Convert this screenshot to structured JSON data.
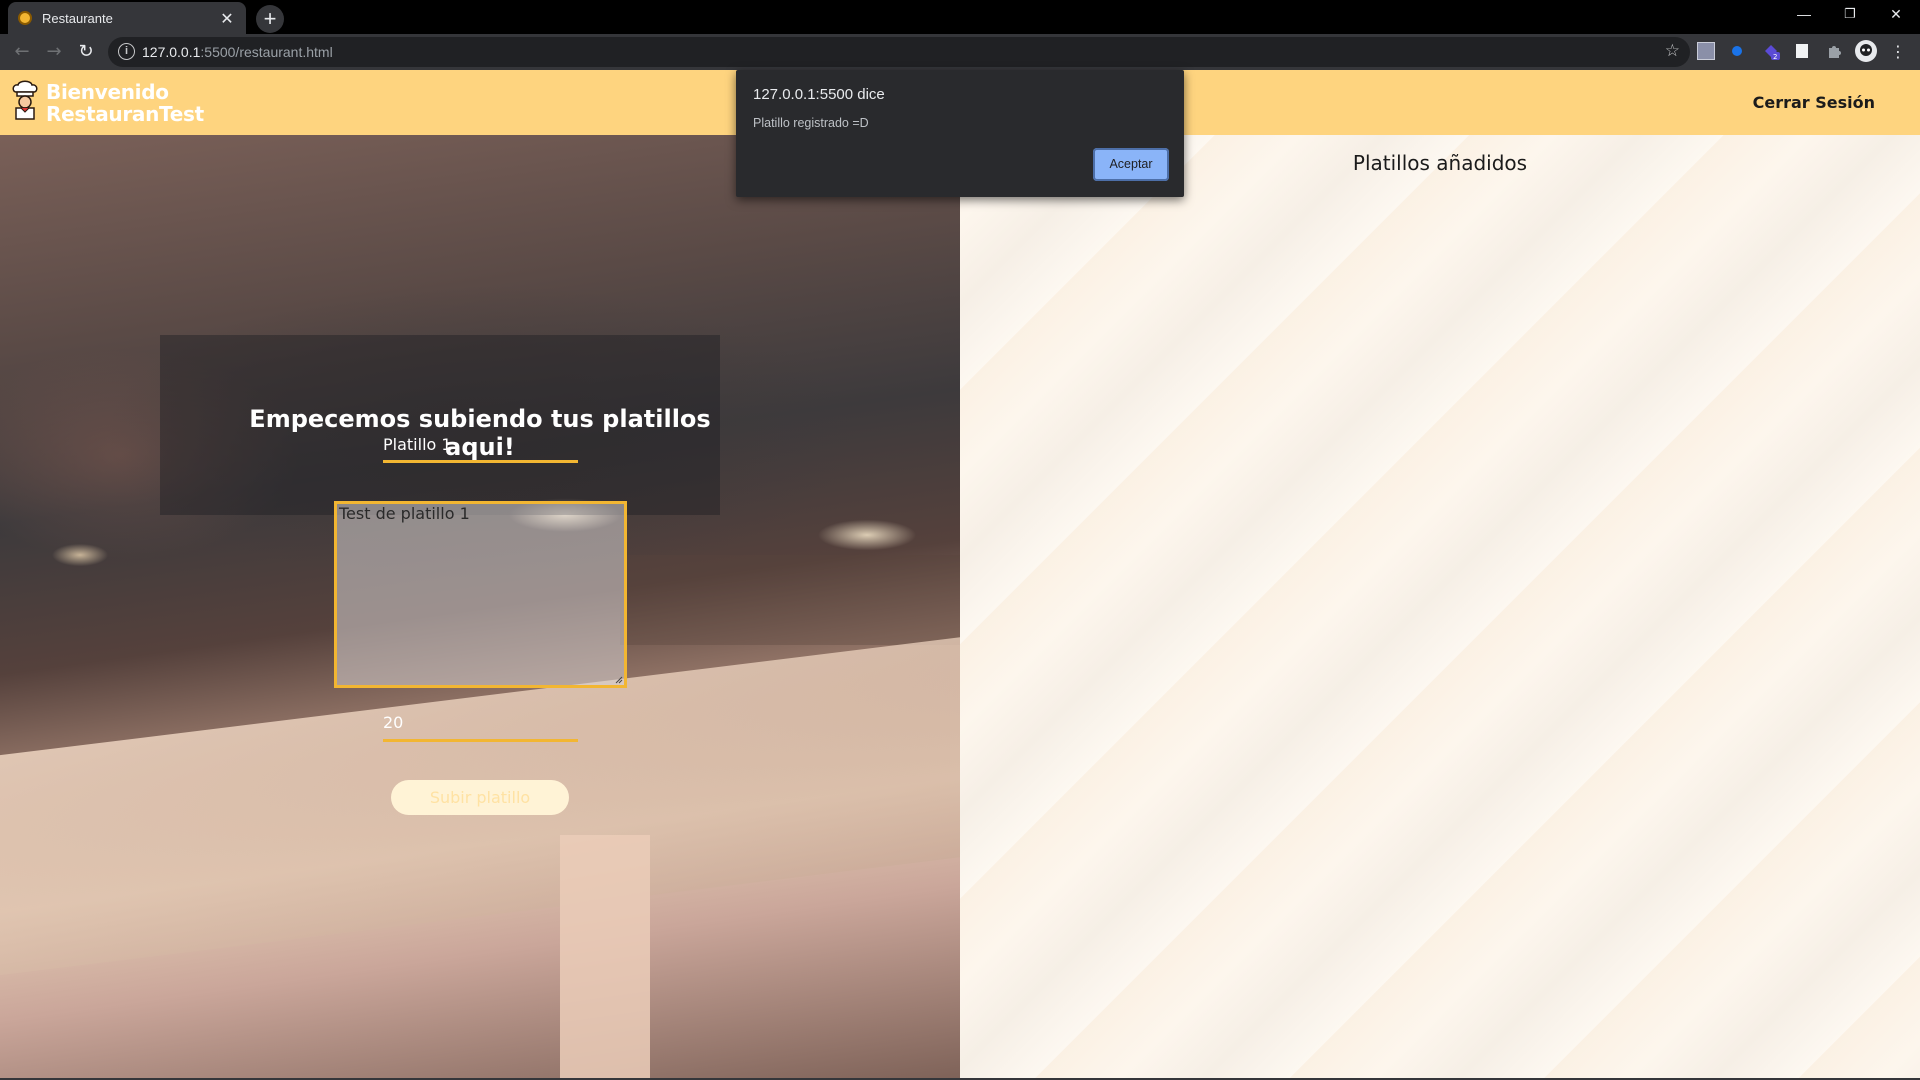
{
  "browser": {
    "tab_title": "Restaurante",
    "tab_close": "✕",
    "new_tab": "+",
    "url_host": "127.0.0.1",
    "url_rest": ":5500/restaurant.html",
    "window_controls": {
      "minimize": "—",
      "restore": "❐",
      "close": "✕"
    }
  },
  "header": {
    "brand_line1": "Bienvenido",
    "brand_line2": "RestauranTest",
    "logout_label": "Cerrar Sesión"
  },
  "form": {
    "title": "Empecemos subiendo tus platillos aqui!",
    "dish_name_value": "Platillo 1",
    "description_value": "Test de platillo 1",
    "price_value": "20",
    "submit_label": "Subir platillo"
  },
  "added_dishes": {
    "title": "Platillos añadidos",
    "items": []
  },
  "alert": {
    "title": "127.0.0.1:5500 dice",
    "message": "Platillo registrado =D",
    "accept_label": "Aceptar"
  },
  "colors": {
    "header_bg": "#fed47f",
    "accent": "#f2b632",
    "alert_button": "#8ab4f8"
  }
}
